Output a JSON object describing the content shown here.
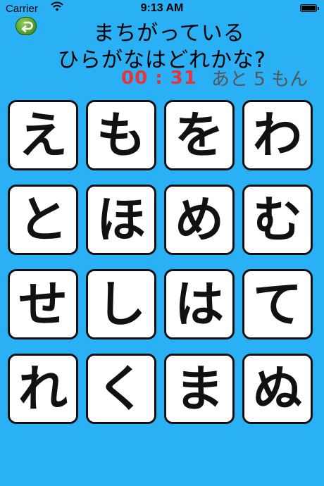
{
  "status_bar": {
    "carrier": "Carrier",
    "time": "9:13 AM"
  },
  "icons": {
    "back": "back-arrow-icon",
    "wifi": "wifi-icon",
    "battery": "battery-icon"
  },
  "colors": {
    "background": "#2ab0f4",
    "timer": "#e8323c",
    "back_button": "#3f8f16"
  },
  "header": {
    "line1": "まちがっている",
    "line2": "ひらがなはどれかな?",
    "timer": "00 : 31",
    "remaining": "あと 5 もん"
  },
  "tiles": [
    "え",
    "も",
    "を",
    "わ",
    "と",
    "ほ",
    "め",
    "む",
    "せ",
    "し",
    "は",
    "て",
    "れ",
    "く",
    "ま",
    "ぬ"
  ]
}
